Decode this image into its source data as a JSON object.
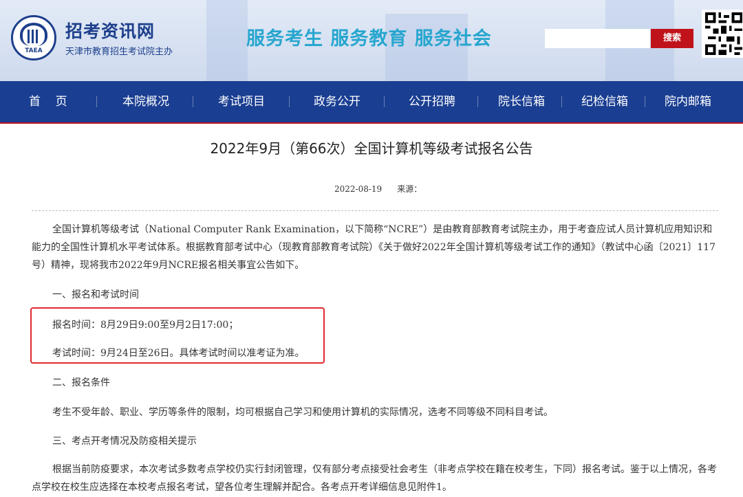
{
  "header": {
    "logo_text": "TAEA",
    "site_name": "招考资讯网",
    "site_sub": "天津市教育招生考试院主办",
    "slogan": "服务考生  服务教育  服务社会",
    "search_placeholder": "",
    "search_button": "搜索"
  },
  "nav": {
    "items": [
      "首    页",
      "本院概况",
      "考试项目",
      "政务公开",
      "公开招聘",
      "院长信箱",
      "纪检信箱",
      "院内邮箱"
    ]
  },
  "article": {
    "title": "2022年9月（第66次）全国计算机等级考试报名公告",
    "date": "2022-08-19",
    "source_label": "来源：",
    "intro": "全国计算机等级考试（National Computer Rank Examination，以下简称“NCRE”）是由教育部教育考试院主办，用于考查应试人员计算机应用知识和能力的全国性计算机水平考试体系。根据教育部考试中心（现教育部教育考试院）《关于做好2022年全国计算机等级考试工作的通知》（教试中心函〔2021〕117号）精神，现将我市2022年9月NCRE报名相关事宜公告如下。",
    "section1": "一、报名和考试时间",
    "reg_time": "报名时间：8月29日9:00至9月2日17:00；",
    "exam_time": "考试时间：9月24日至26日。具体考试时间以准考证为准。",
    "section2": "二、报名条件",
    "conditions": "考生不受年龄、职业、学历等条件的限制，均可根据自己学习和使用计算机的实际情况，选考不同等级不同科目考试。",
    "section3": "三、考点开考情况及防疫相关提示",
    "epidemic": "根据当前防疫要求，本次考试多数考点学校仍实行封闭管理，仅有部分考点接受社会考生（非考点学校在籍在校考生，下同）报名考试。鉴于以上情况，各考点学校在校生应选择在本校考点报名考试，望各位考生理解并配合。各考点开考详细信息见附件1。"
  },
  "colors": {
    "nav_bg": "#1a3e91",
    "accent_red": "#c0121a",
    "slogan": "#27a6cf",
    "highlight_box": "#e0282f"
  }
}
